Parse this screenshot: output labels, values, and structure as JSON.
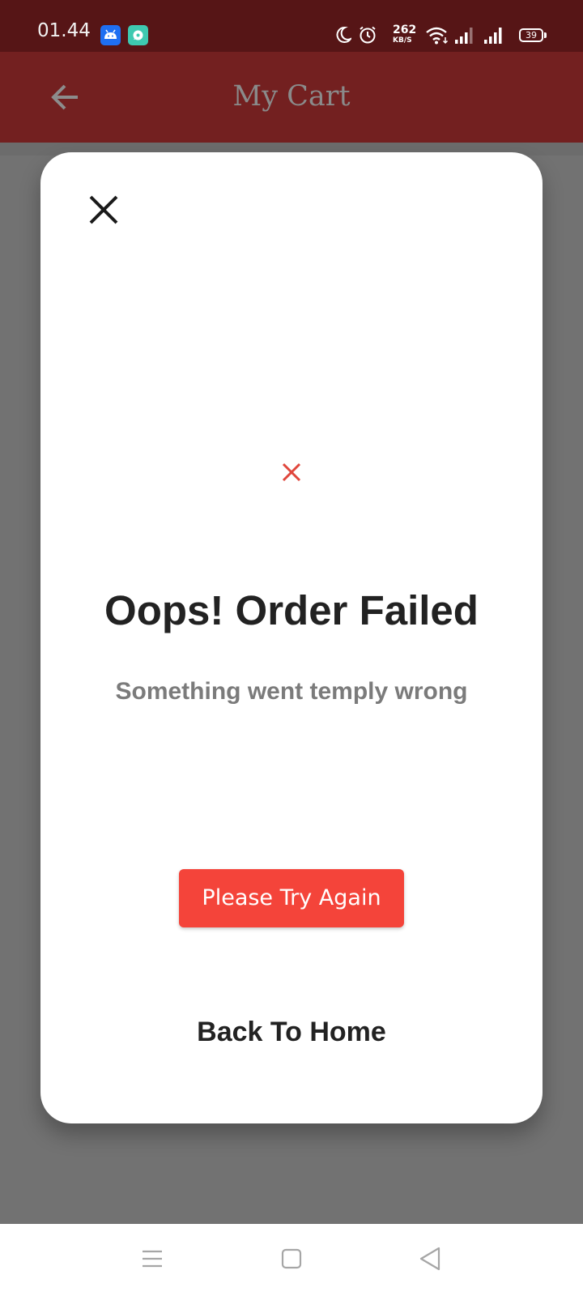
{
  "status_bar": {
    "time": "01.44",
    "network_speed": "262",
    "network_speed_unit": "KB/S",
    "battery_level": "39",
    "app_icons": [
      "android-icon",
      "chat-app-icon"
    ],
    "status_icons": [
      "moon-icon",
      "alarm-icon",
      "wifi-icon",
      "signal-icon",
      "signal-icon"
    ]
  },
  "app_bar": {
    "title": "My Cart",
    "back_icon": "arrow-left-icon"
  },
  "dialog": {
    "close_icon": "close-icon",
    "status_icon": "error-x-icon",
    "title": "Oops! Order Failed",
    "message": "Something went temply wrong",
    "primary_button": "Please Try Again",
    "secondary_link": "Back To Home"
  },
  "nav_bar": {
    "icons": [
      "menu-icon",
      "home-icon",
      "back-icon"
    ]
  },
  "colors": {
    "status_bar": "#561516",
    "app_bar": "#732020",
    "scrim": "#727272",
    "accent_red": "#f4443a",
    "error_mark": "#e0463c",
    "title_text": "#222222",
    "subtitle_text": "#7b7b7b"
  }
}
